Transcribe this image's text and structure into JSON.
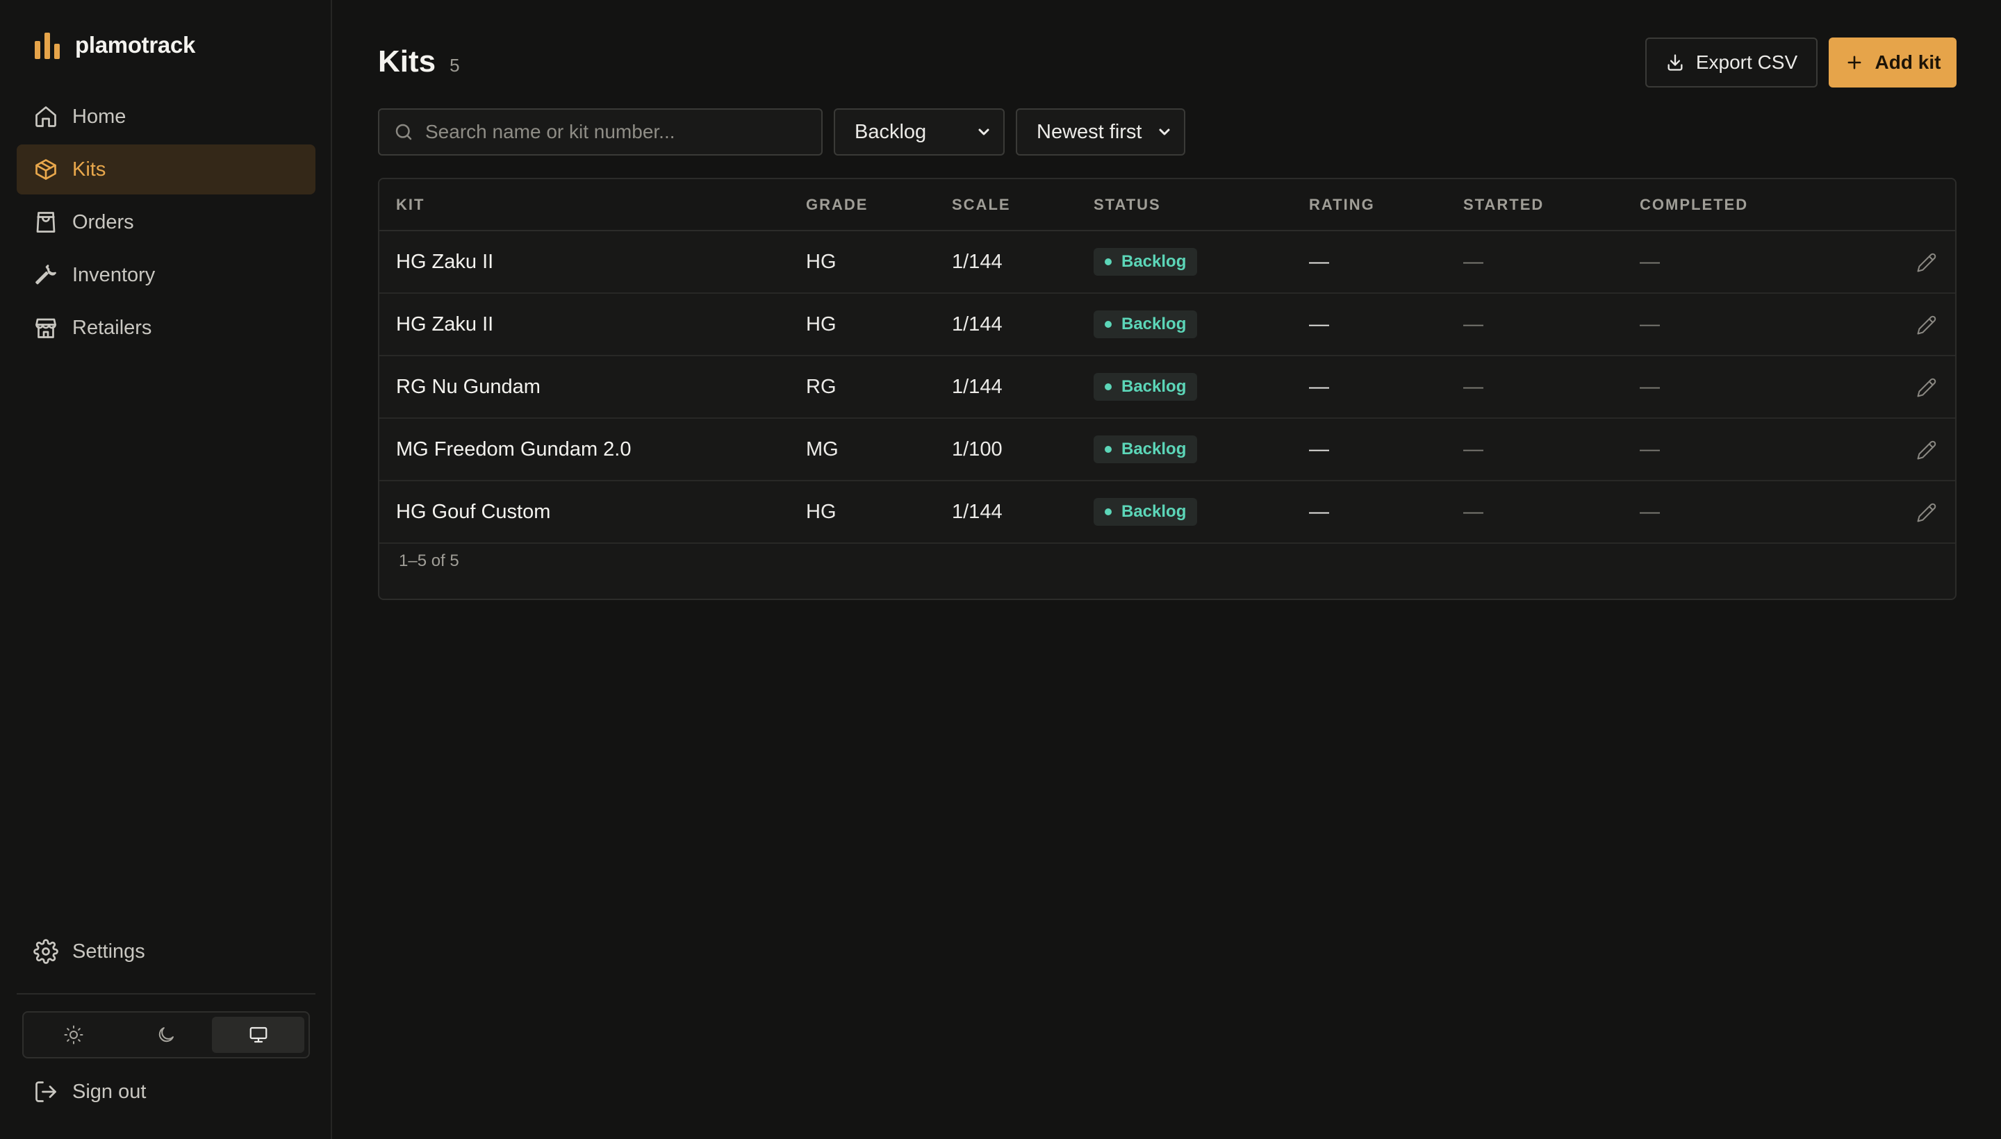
{
  "app": {
    "name": "plamotrack"
  },
  "sidebar": {
    "items": [
      {
        "label": "Home",
        "icon": "home-icon",
        "active": false
      },
      {
        "label": "Kits",
        "icon": "box-icon",
        "active": true
      },
      {
        "label": "Orders",
        "icon": "shopping-bag-icon",
        "active": false
      },
      {
        "label": "Inventory",
        "icon": "wrench-icon",
        "active": false
      },
      {
        "label": "Retailers",
        "icon": "store-icon",
        "active": false
      }
    ],
    "settings_label": "Settings",
    "signout_label": "Sign out",
    "theme_options": [
      "light",
      "dark",
      "system"
    ],
    "theme_selected": "system"
  },
  "header": {
    "title": "Kits",
    "count": "5",
    "export_label": "Export CSV",
    "add_label": "Add kit"
  },
  "filters": {
    "search_placeholder": "Search name or kit number...",
    "status_selected": "Backlog",
    "sort_selected": "Newest first"
  },
  "table": {
    "columns": [
      "KIT",
      "GRADE",
      "SCALE",
      "STATUS",
      "RATING",
      "STARTED",
      "COMPLETED"
    ],
    "rows": [
      {
        "kit": "HG Zaku II",
        "grade": "HG",
        "scale": "1/144",
        "status": "Backlog",
        "rating": "—",
        "started": "—",
        "completed": "—"
      },
      {
        "kit": "HG Zaku II",
        "grade": "HG",
        "scale": "1/144",
        "status": "Backlog",
        "rating": "—",
        "started": "—",
        "completed": "—"
      },
      {
        "kit": "RG Nu Gundam",
        "grade": "RG",
        "scale": "1/144",
        "status": "Backlog",
        "rating": "—",
        "started": "—",
        "completed": "—"
      },
      {
        "kit": "MG Freedom Gundam 2.0",
        "grade": "MG",
        "scale": "1/100",
        "status": "Backlog",
        "rating": "—",
        "started": "—",
        "completed": "—"
      },
      {
        "kit": "HG Gouf Custom",
        "grade": "HG",
        "scale": "1/144",
        "status": "Backlog",
        "rating": "—",
        "started": "—",
        "completed": "—"
      }
    ],
    "footer": "1–5 of 5"
  },
  "colors": {
    "accent": "#e6a44a",
    "status_backlog": "#5cd6b8",
    "background": "#131312"
  }
}
